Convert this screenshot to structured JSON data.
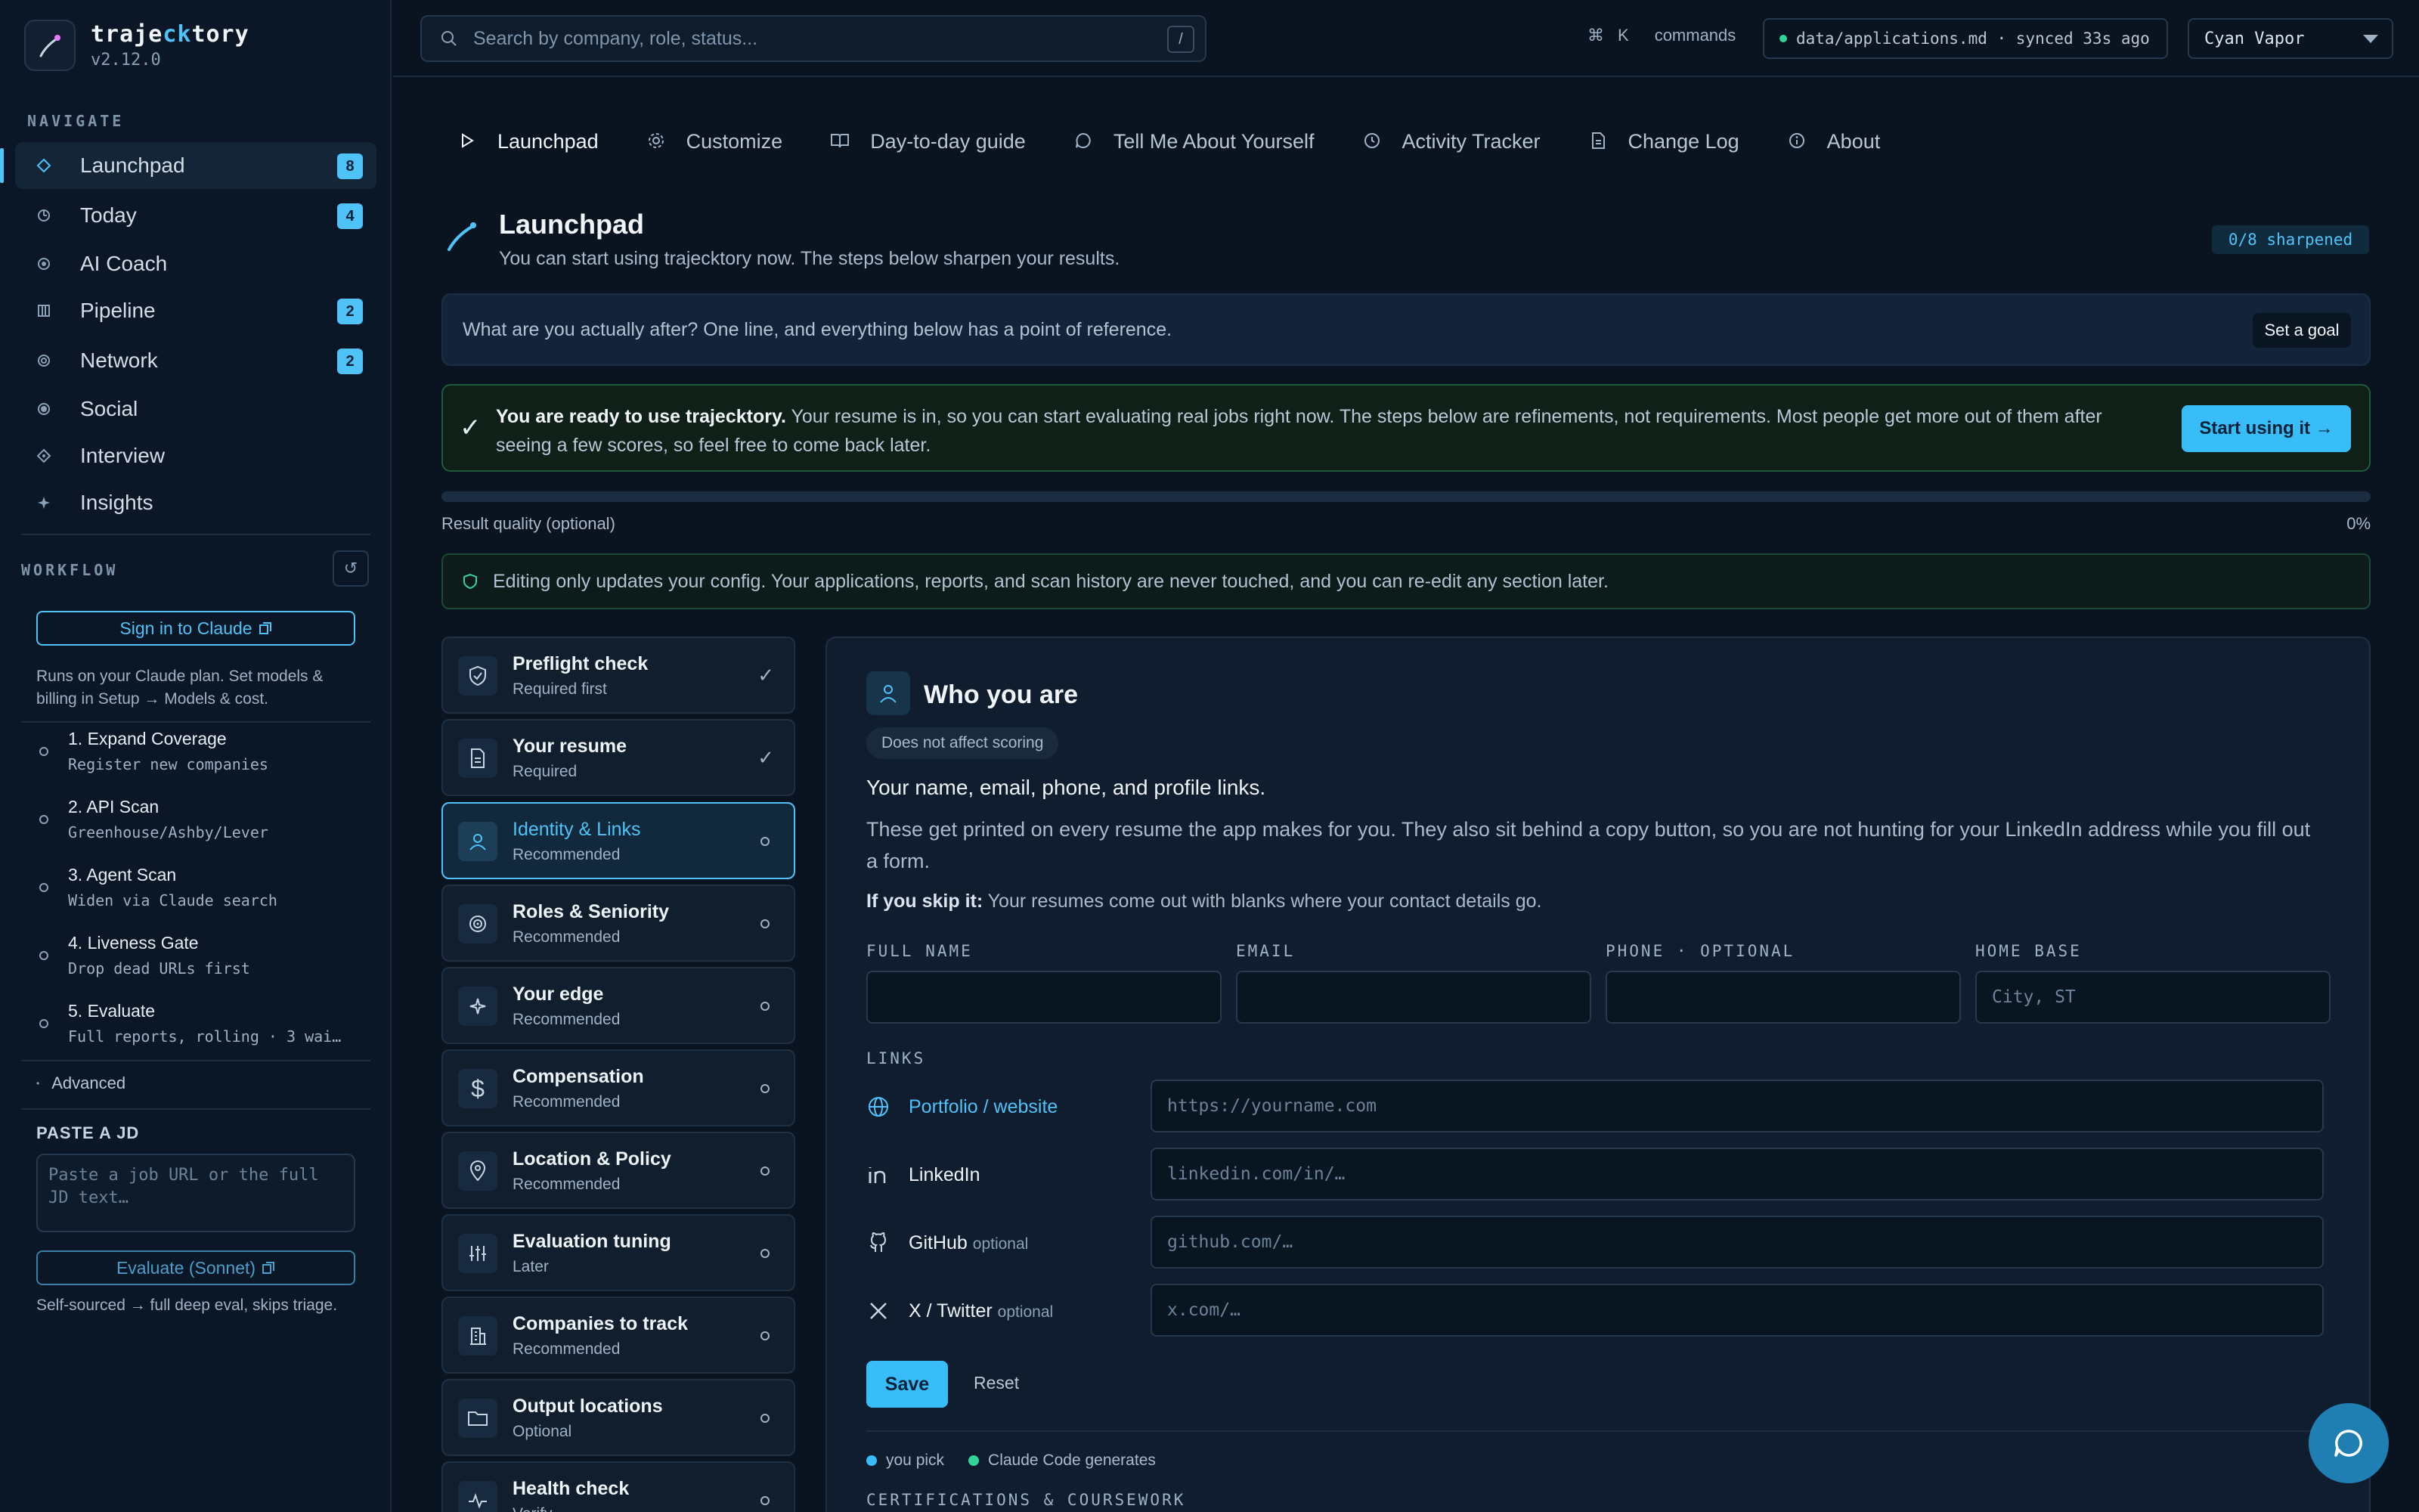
{
  "app": {
    "name_prefix": "traje",
    "name_highlight": "ck",
    "name_suffix": "tory",
    "version": "v2.12.0"
  },
  "sidebar": {
    "navigate_label": "NAVIGATE",
    "nav": [
      {
        "label": "Launchpad",
        "icon": "diamond-icon",
        "badge": "8",
        "active": true
      },
      {
        "label": "Today",
        "icon": "clock-icon",
        "badge": "4"
      },
      {
        "label": "AI Coach",
        "icon": "target-icon",
        "badge": ""
      },
      {
        "label": "Pipeline",
        "icon": "columns-icon",
        "badge": "2"
      },
      {
        "label": "Network",
        "icon": "ring-icon",
        "badge": "2"
      },
      {
        "label": "Social",
        "icon": "dot-icon",
        "badge": ""
      },
      {
        "label": "Interview",
        "icon": "diamond-dot-icon",
        "badge": ""
      },
      {
        "label": "Insights",
        "icon": "sparkle-icon",
        "badge": ""
      }
    ],
    "workflow_label": "WORKFLOW",
    "signin_label": "Sign in to Claude",
    "plan_note": "Runs on your Claude plan. Set models & billing in Setup → Models & cost.",
    "steps": [
      {
        "title": "1. Expand Coverage",
        "sub": "Register new companies"
      },
      {
        "title": "2. API Scan",
        "sub": "Greenhouse/Ashby/Lever"
      },
      {
        "title": "3. Agent Scan",
        "sub": "Widen via Claude search"
      },
      {
        "title": "4. Liveness Gate",
        "sub": "Drop dead URLs first"
      },
      {
        "title": "5. Evaluate",
        "sub": "Full reports, rolling · 3 wai…"
      }
    ],
    "advanced_label": "Advanced",
    "paste_label": "PASTE A JD",
    "paste_placeholder": "Paste a job URL or the full JD text…",
    "evaluate_label": "Evaluate (Sonnet)",
    "evaluate_note": "Self-sourced → full deep eval, skips triage."
  },
  "topbar": {
    "search_placeholder": "Search by company, role, status...",
    "search_shortcut": "/",
    "cmd_symbol": "⌘",
    "cmd_key": "K",
    "cmd_label": "commands",
    "sync_text": "data/applications.md · synced 33s ago",
    "theme": "Cyan Vapor"
  },
  "tabs": [
    {
      "label": "Launchpad",
      "icon": "play-icon",
      "active": true
    },
    {
      "label": "Customize",
      "icon": "gear-icon"
    },
    {
      "label": "Day-to-day guide",
      "icon": "book-icon"
    },
    {
      "label": "Tell Me About Yourself",
      "icon": "chat-icon"
    },
    {
      "label": "Activity Tracker",
      "icon": "clock-icon"
    },
    {
      "label": "Change Log",
      "icon": "document-icon"
    },
    {
      "label": "About",
      "icon": "info-icon"
    }
  ],
  "page": {
    "title": "Launchpad",
    "subtitle": "You can start using trajecktory now. The steps below sharpen your results.",
    "sharpened": "0/8 sharpened",
    "goal_prompt": "What are you actually after? One line, and everything below has a point of reference.",
    "goal_button": "Set a goal",
    "ready_bold": "You are ready to use trajecktory.",
    "ready_text": " Your resume is in, so you can start evaluating real jobs right now. The steps below are refinements, not requirements. Most people get more out of them after seeing a few scores, so feel free to come back later.",
    "start_button": "Start using it →",
    "quality_label": "Result quality (optional)",
    "quality_value": 0,
    "quality_pct": "0%",
    "config_note": "Editing only updates your config. Your applications, reports, and scan history are never touched, and you can re-edit any section later."
  },
  "sections": [
    {
      "title": "Preflight check",
      "sub": "Required first",
      "icon": "shield-icon",
      "done": true
    },
    {
      "title": "Your resume",
      "sub": "Required",
      "icon": "document-icon",
      "done": true
    },
    {
      "title": "Identity & Links",
      "sub": "Recommended",
      "icon": "user-icon",
      "active": true
    },
    {
      "title": "Roles & Seniority",
      "sub": "Recommended",
      "icon": "target-icon"
    },
    {
      "title": "Your edge",
      "sub": "Recommended",
      "icon": "sparkle-icon"
    },
    {
      "title": "Compensation",
      "sub": "Recommended",
      "icon": "dollar-icon"
    },
    {
      "title": "Location & Policy",
      "sub": "Recommended",
      "icon": "pin-icon"
    },
    {
      "title": "Evaluation tuning",
      "sub": "Later",
      "icon": "sliders-icon"
    },
    {
      "title": "Companies to track",
      "sub": "Recommended",
      "icon": "building-icon"
    },
    {
      "title": "Output locations",
      "sub": "Optional",
      "icon": "folder-icon"
    },
    {
      "title": "Health check",
      "sub": "Verify",
      "icon": "pulse-icon"
    }
  ],
  "identity": {
    "title": "Who you are",
    "chip": "Does not affect scoring",
    "lead": "Your name, email, phone, and profile links.",
    "body": "These get printed on every resume the app makes for you. They also sit behind a copy button, so you are not hunting for your LinkedIn address while you fill out a form.",
    "skip_bold": "If you skip it:",
    "skip_text": " Your resumes come out with blanks where your contact details go.",
    "fields": [
      {
        "label": "FULL NAME",
        "placeholder": "",
        "value": ""
      },
      {
        "label": "EMAIL",
        "placeholder": "",
        "value": ""
      },
      {
        "label": "PHONE · OPTIONAL",
        "placeholder": "",
        "value": ""
      },
      {
        "label": "HOME BASE",
        "placeholder": "City, ST",
        "value": ""
      }
    ],
    "links_label": "LINKS",
    "links": [
      {
        "name": "Portfolio / website",
        "optional": "",
        "placeholder": "https://yourname.com",
        "icon": "globe-icon"
      },
      {
        "name": "LinkedIn",
        "optional": "",
        "placeholder": "linkedin.com/in/…",
        "icon": "linkedin-icon"
      },
      {
        "name": "GitHub",
        "optional": "optional",
        "placeholder": "github.com/…",
        "icon": "github-icon"
      },
      {
        "name": "X / Twitter",
        "optional": "optional",
        "placeholder": "x.com/…",
        "icon": "x-icon"
      }
    ],
    "save_label": "Save",
    "reset_label": "Reset",
    "legend_you": "you pick",
    "legend_claude": "Claude Code generates",
    "cert_label": "CERTIFICATIONS & COURSEWORK"
  },
  "colors": {
    "accent": "#4fc3f7",
    "success": "#34d399",
    "background": "#0a1320"
  }
}
